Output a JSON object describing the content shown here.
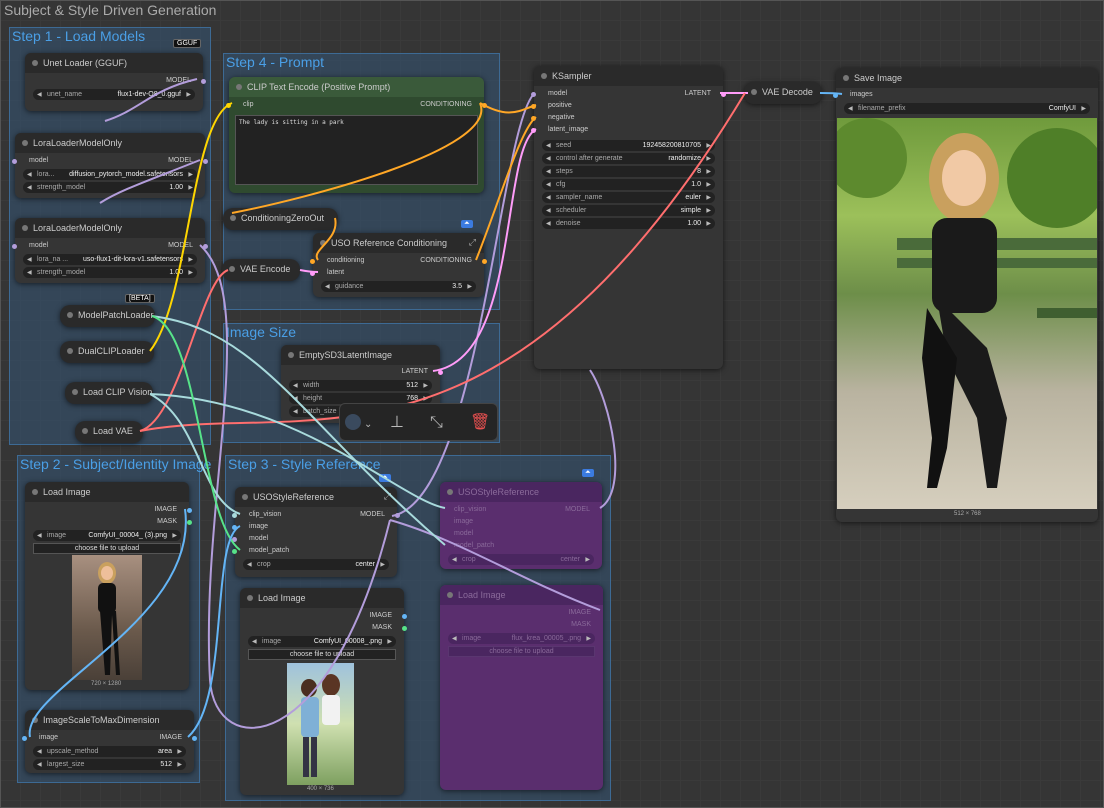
{
  "app_title": "Subject & Style Driven Generation",
  "groups": {
    "step1": "Step 1 - Load Models",
    "step4": "Step 4 - Prompt",
    "image_size": "Image Size",
    "step2": "Step 2 - Subject/Identity Image",
    "step3": "Step 3 - Style Reference"
  },
  "badges": {
    "gguf": "GGUF",
    "beta": "[BETA]"
  },
  "unet": {
    "title": "Unet Loader (GGUF)",
    "out": "MODEL",
    "w_label": "unet_name",
    "w_value": "flux1-dev-Q8_0.gguf"
  },
  "lora1": {
    "title": "LoraLoaderModelOnly",
    "in": "model",
    "out": "MODEL",
    "w1_label": "lora...",
    "w1_value": "diffusion_pytorch_model.safetensors",
    "w2_label": "strength_model",
    "w2_value": "1.00"
  },
  "lora2": {
    "title": "LoraLoaderModelOnly",
    "in": "model",
    "out": "MODEL",
    "w1_label": "lora_na ...",
    "w1_value": "uso-flux1-dit-lora-v1.safetensors",
    "w2_label": "strength_model",
    "w2_value": "1.00"
  },
  "collapsed": {
    "modelpatch": "ModelPatchLoader",
    "dualclip": "DualCLIPLoader",
    "clipvision": "Load CLIP Vision",
    "vae": "Load VAE",
    "vaeencode": "VAE Encode",
    "condzero": "ConditioningZeroOut",
    "vaedecode": "VAE Decode"
  },
  "clip_text": {
    "title": "CLIP Text Encode (Positive Prompt)",
    "in": "clip",
    "out": "CONDITIONING",
    "text": "The lady is sitting in a park"
  },
  "uso_ref": {
    "title": "USO Reference Conditioning",
    "in1": "conditioning",
    "in2": "latent",
    "out": "CONDITIONING",
    "w_label": "guidance",
    "w_value": "3.5"
  },
  "vae_encode": {
    "in_latent": "latent"
  },
  "empty_latent": {
    "title": "EmptySD3LatentImage",
    "out": "LATENT",
    "w1_label": "width",
    "w1_value": "512",
    "w2_label": "height",
    "w2_value": "768",
    "w3_label": "batch_size",
    "w3_value": "1"
  },
  "ksampler": {
    "title": "KSampler",
    "in1": "model",
    "in2": "positive",
    "in3": "negative",
    "in4": "latent_image",
    "out": "LATENT",
    "widgets": [
      {
        "label": "seed",
        "value": "192458200810705"
      },
      {
        "label": "control after generate",
        "value": "randomize"
      },
      {
        "label": "steps",
        "value": "8"
      },
      {
        "label": "cfg",
        "value": "1.0"
      },
      {
        "label": "sampler_name",
        "value": "euler"
      },
      {
        "label": "scheduler",
        "value": "simple"
      },
      {
        "label": "denoise",
        "value": "1.00"
      }
    ]
  },
  "save": {
    "title": "Save Image",
    "in": "images",
    "w_label": "filename_prefix",
    "w_value": "ComfyUI",
    "dims": "512 × 768"
  },
  "load1": {
    "title": "Load Image",
    "out1": "IMAGE",
    "out2": "MASK",
    "w_label": "image",
    "w_value": "ComfyUI_00004_ (3).png",
    "btn": "choose file to upload",
    "dims": "720 × 1280"
  },
  "scale": {
    "title": "ImageScaleToMaxDimension",
    "in": "image",
    "out": "IMAGE",
    "w1_label": "upscale_method",
    "w1_value": "area",
    "w2_label": "largest_size",
    "w2_value": "512"
  },
  "uso_style": {
    "title": "USOStyleReference",
    "in1": "clip_vision",
    "in2": "image",
    "in3": "model",
    "in4": "model_patch",
    "out": "MODEL",
    "w_label": "crop",
    "w_value": "center"
  },
  "load2": {
    "title": "Load Image",
    "out1": "IMAGE",
    "out2": "MASK",
    "w_label": "image",
    "w_value": "ComfyUI_00008_.png",
    "btn": "choose file to upload",
    "dims": "400 × 736"
  },
  "uso_style_b": {
    "title": "USOStyleReference",
    "in1": "clip_vision",
    "in2": "image",
    "in3": "model",
    "in4": "model_patch",
    "out": "MODEL",
    "w_label": "crop",
    "w_value": "center"
  },
  "load3": {
    "title": "Load Image",
    "out1": "IMAGE",
    "out2": "MASK",
    "w_label": "image",
    "w_value": "flux_krea_00005_.png",
    "btn": "choose file to upload"
  },
  "colors": {
    "model": "#b39ddb",
    "clip": "#ffd600",
    "conditioning": "#ffa726",
    "latent": "#ff9cf9",
    "image": "#64b5f6",
    "vae": "#ff6e6e",
    "clip_vision": "#a8dadc",
    "model_patch": "#57e389"
  }
}
